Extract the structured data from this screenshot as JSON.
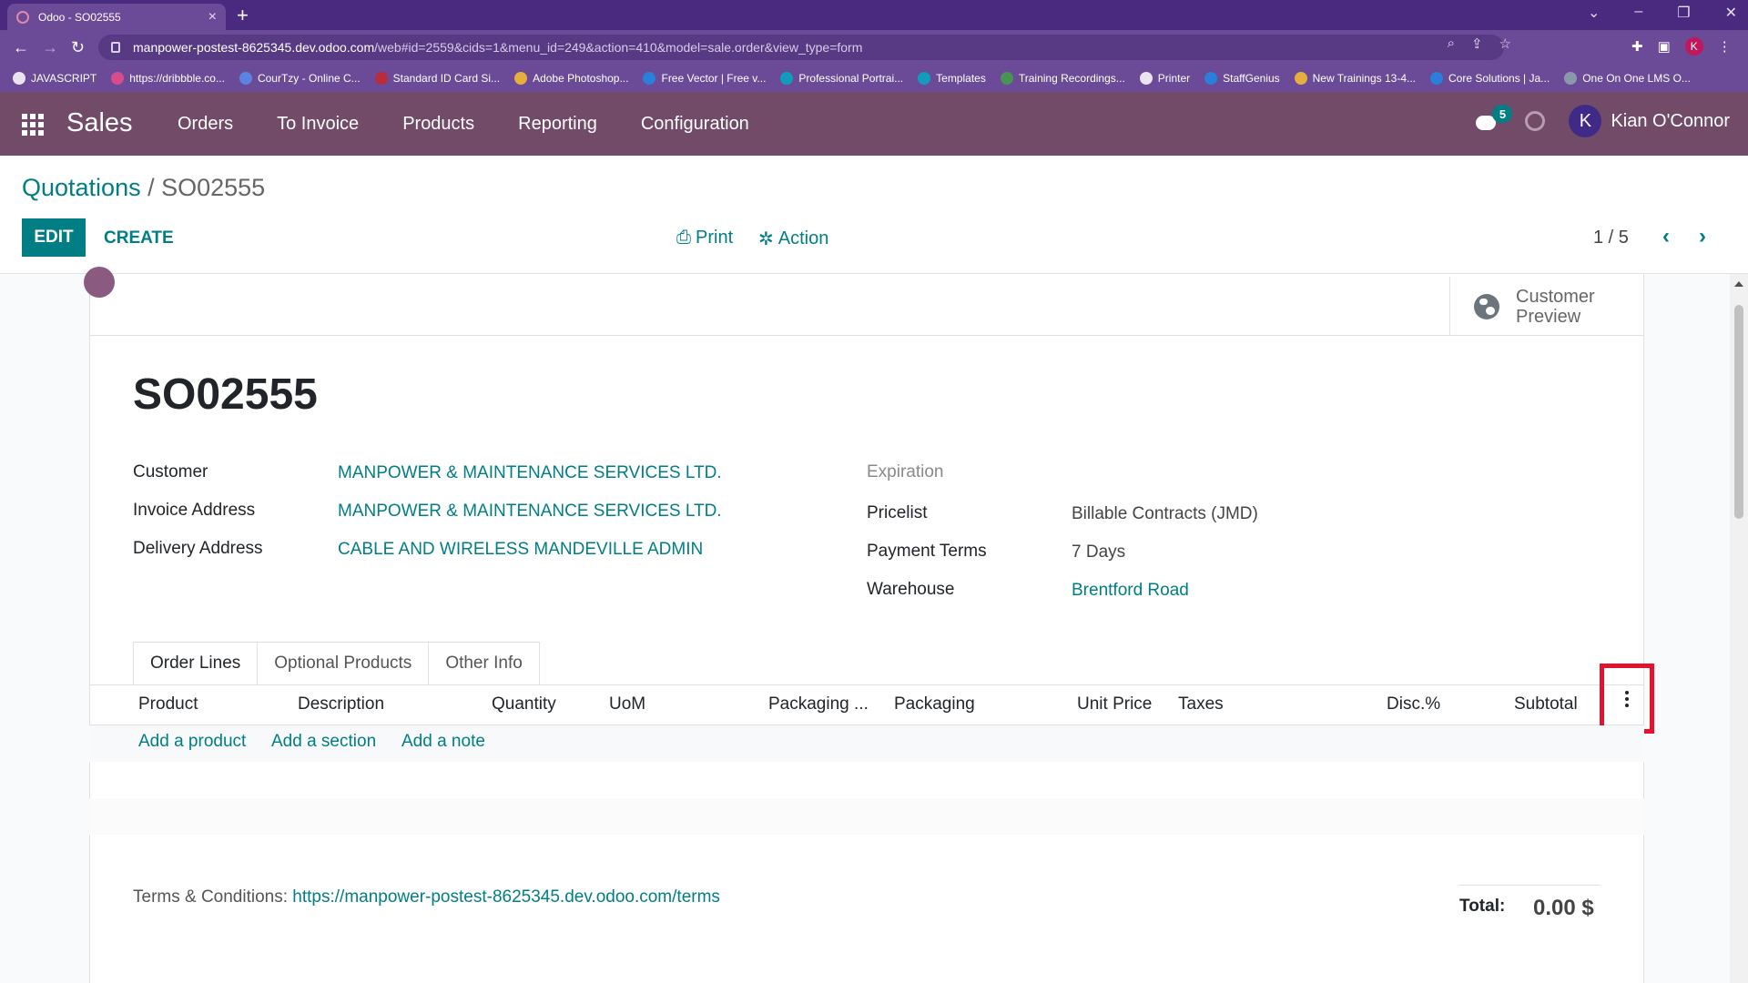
{
  "browser": {
    "tab_title": "Odoo - SO02555",
    "tab_close": "×",
    "new_tab": "+",
    "url_host": "manpower-postest-8625345.dev.odoo.com",
    "url_path": "/web#id=2559&cids=1&menu_id=249&action=410&model=sale.order&view_type=form",
    "bookmarks": [
      "JAVASCRIPT",
      "https://dribbble.co...",
      "CourTzy - Online C...",
      "Standard ID Card Si...",
      "Adobe Photoshop...",
      "Free Vector | Free v...",
      "Professional Portrai...",
      "Templates",
      "Training Recordings...",
      "Printer",
      "StaffGenius",
      "New Trainings 13-4...",
      "Core Solutions | Ja...",
      "One On One LMS O..."
    ],
    "profile_initial": "K"
  },
  "nav": {
    "brand": "Sales",
    "menu": [
      "Orders",
      "To Invoice",
      "Products",
      "Reporting",
      "Configuration"
    ],
    "messages_count": "5",
    "user_initial": "K",
    "user_name": "Kian O'Connor"
  },
  "control_panel": {
    "breadcrumb_parent": "Quotations",
    "breadcrumb_sep": " / ",
    "breadcrumb_current": "SO02555",
    "edit_label": "EDIT",
    "create_label": "CREATE",
    "print_label": "Print",
    "action_label": "Action",
    "pager": "1 / 5"
  },
  "form": {
    "preview_label_1": "Customer",
    "preview_label_2": "Preview",
    "title": "SO02555",
    "customer_label": "Customer",
    "customer_value": "MANPOWER & MAINTENANCE SERVICES LTD.",
    "invoice_label": "Invoice Address",
    "invoice_value": "MANPOWER & MAINTENANCE SERVICES LTD.",
    "delivery_label": "Delivery Address",
    "delivery_value": "CABLE AND WIRELESS MANDEVILLE ADMIN",
    "expiration_label": "Expiration",
    "pricelist_label": "Pricelist",
    "pricelist_value": "Billable Contracts (JMD)",
    "payment_terms_label": "Payment Terms",
    "payment_terms_value": "7 Days",
    "warehouse_label": "Warehouse",
    "warehouse_value": "Brentford Road"
  },
  "notebook": {
    "tabs": [
      "Order Lines",
      "Optional Products",
      "Other Info"
    ],
    "columns": [
      "Product",
      "Description",
      "Quantity",
      "UoM",
      "Packaging ...",
      "Packaging",
      "Unit Price",
      "Taxes",
      "Disc.%",
      "Subtotal"
    ],
    "add_product": "Add a product",
    "add_section": "Add a section",
    "add_note": "Add a note"
  },
  "footer": {
    "terms_label": "Terms & Conditions: ",
    "terms_link": "https://manpower-postest-8625345.dev.odoo.com/terms",
    "total_label": "Total:",
    "total_value": "0.00 $"
  },
  "colors": {
    "odoo_primary": "#714b67",
    "odoo_accent": "#017e84",
    "highlight_box": "#e3122e"
  }
}
